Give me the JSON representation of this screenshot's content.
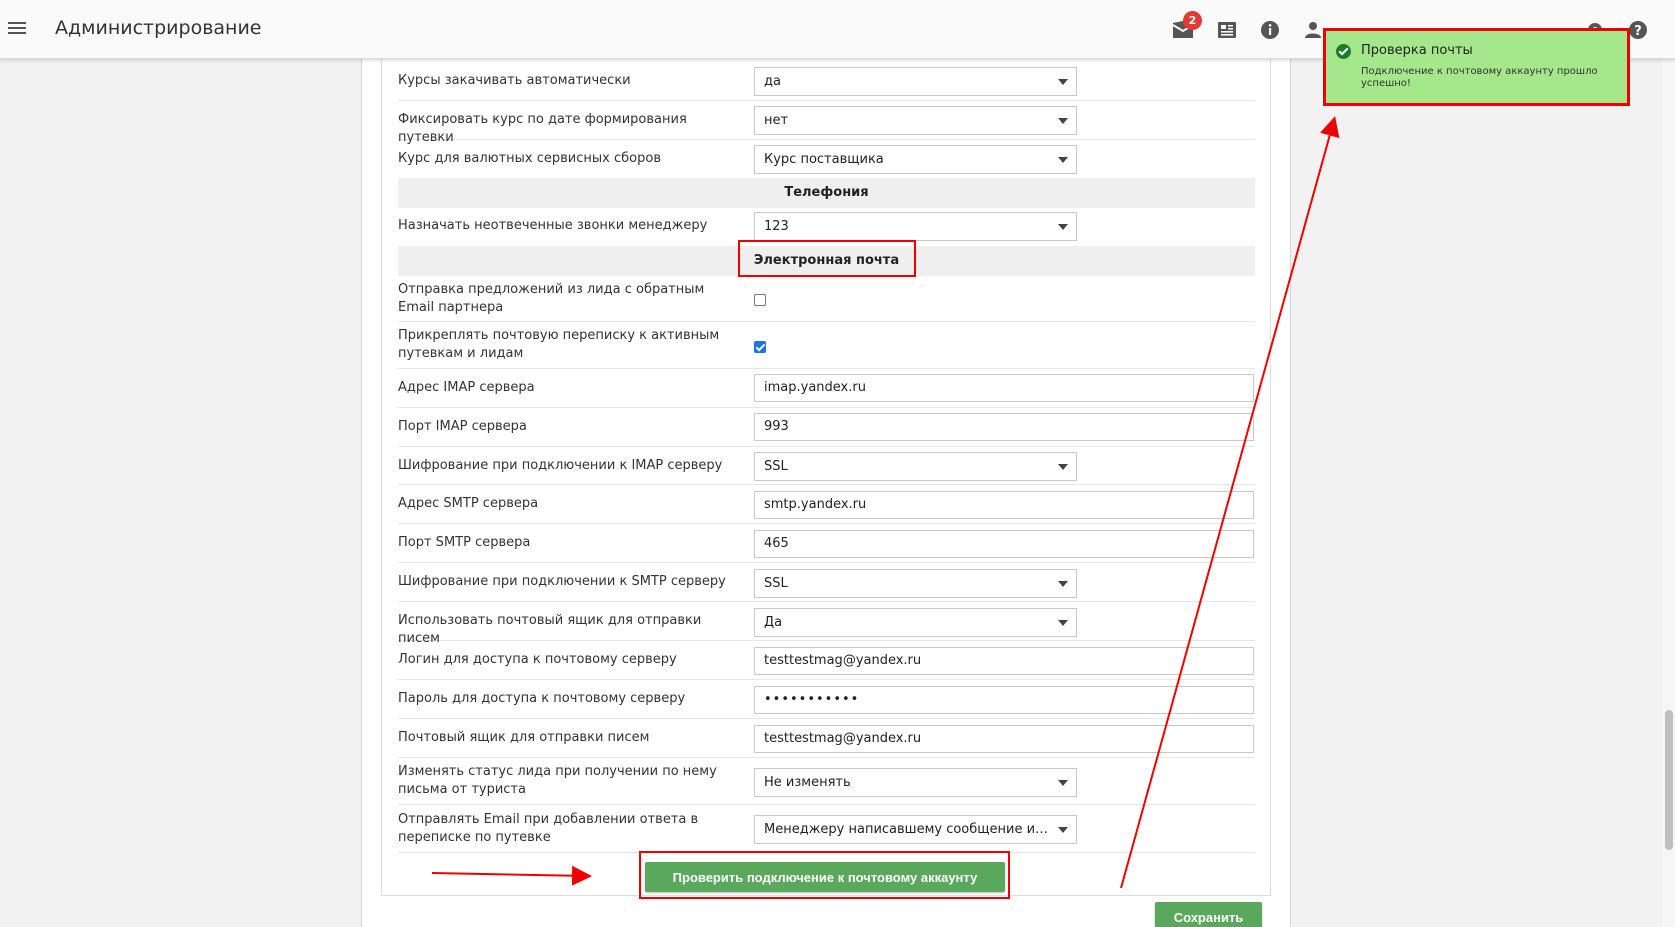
{
  "header": {
    "title": "Администрирование",
    "mail_badge_count": "2",
    "icons": [
      "menu-icon",
      "mail-icon",
      "news-icon",
      "info-icon",
      "user-icon",
      "settings-icon",
      "help-icon"
    ]
  },
  "rows_top": [
    {
      "label": "Курсы закачивать автоматически",
      "value": "да"
    },
    {
      "label": "Фиксировать курс по дате формирования путевки",
      "value": "нет"
    },
    {
      "label": "Курс для валютных сервисных сборов",
      "value": "Курс поставщика"
    }
  ],
  "section_telephony": "Телефония",
  "row_calls": {
    "label": "Назначать неотвеченные звонки менеджеру",
    "value": "123"
  },
  "section_email": "Электронная почта",
  "checkbox_rows": [
    {
      "label": "Отправка предложений из лида с обратным Email партнера",
      "checked": false
    },
    {
      "label": "Прикреплять почтовую переписку к активным путевкам и лидам",
      "checked": true
    }
  ],
  "email_fields": {
    "imap_address": {
      "label": "Адрес IMAP сервера",
      "value": "imap.yandex.ru"
    },
    "imap_port": {
      "label": "Порт IMAP сервера",
      "value": "993"
    },
    "imap_encryption": {
      "label": "Шифрование при подключении к IMAP серверу",
      "value": "SSL"
    },
    "smtp_address": {
      "label": "Адрес SMTP сервера",
      "value": "smtp.yandex.ru"
    },
    "smtp_port": {
      "label": "Порт SMTP сервера",
      "value": "465"
    },
    "smtp_encryption": {
      "label": "Шифрование при подключении к SMTP серверу",
      "value": "SSL"
    },
    "use_mailbox": {
      "label": "Использовать почтовый ящик для отправки писем",
      "value": "Да"
    },
    "login": {
      "label": "Логин для доступа к почтовому серверу",
      "value": "testtestmag@yandex.ru"
    },
    "password": {
      "label": "Пароль для доступа к почтовому серверу",
      "value": "•••••••••••"
    },
    "sender_mailbox": {
      "label": "Почтовый ящик для отправки писем",
      "value": "testtestmag@yandex.ru"
    },
    "lead_status": {
      "label": "Изменять статус лида при получении по нему письма от туриста",
      "value": "Не изменять"
    },
    "reply_email": {
      "label": "Отправлять Email при добавлении ответа в переписке по путевке",
      "value": "Менеджеру написавшему сообщение и ответственному"
    }
  },
  "buttons": {
    "check_connection": "Проверить подключение к почтовому аккаунту",
    "save": "Сохранить"
  },
  "toast": {
    "title": "Проверка почты",
    "message": "Подключение к почтовому аккаунту прошло успешно!"
  },
  "colors": {
    "accent_green": "#5aa85c",
    "toast_bg": "#a5e88b",
    "annotation_red": "#e00000",
    "badge_red": "#e53935"
  }
}
